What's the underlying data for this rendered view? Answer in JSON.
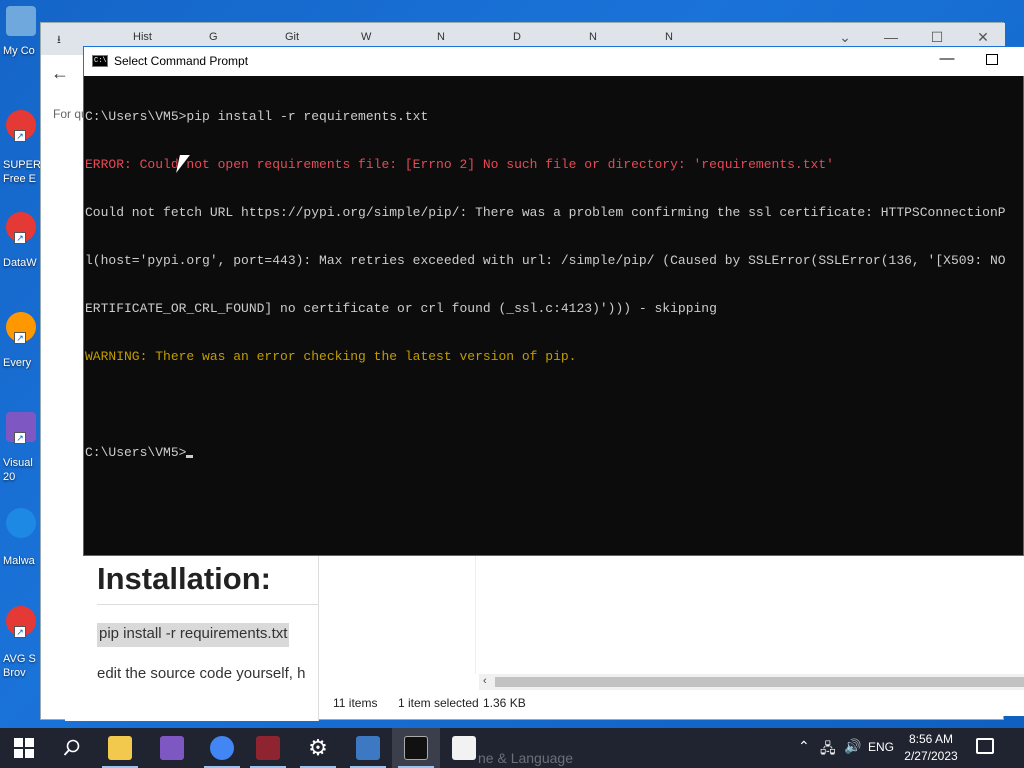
{
  "desktop": {
    "icons": [
      {
        "label": "My Co",
        "color": "#6fa8dc"
      },
      {
        "label": "SUPER",
        "label2": "Free E",
        "color": "#e53935"
      },
      {
        "label": "DataW",
        "color": "#e53935"
      },
      {
        "label": "Every",
        "color": "#ff9800"
      },
      {
        "label": "Visual",
        "label2": "20",
        "color": "#7e57c2"
      },
      {
        "label": "Malwa",
        "color": "#1e88e5"
      },
      {
        "label": "AVG S",
        "label2": "Brov",
        "color": "#e53935"
      }
    ]
  },
  "browser": {
    "tabs": [
      "",
      "Hist",
      "G",
      "Git",
      "W",
      "N",
      "D",
      "N",
      "N"
    ],
    "for_q": "For qu",
    "install_title": "Installation:",
    "code_line": "pip install -r requirements.txt",
    "edit_text": "edit the source code yourself, h"
  },
  "explorer": {
    "items_count": "11 items",
    "selected": "1 item selected",
    "size": "1.36 KB"
  },
  "cmd": {
    "title": "Select Command Prompt",
    "icon_text": "C:\\",
    "lines": [
      {
        "cls": "",
        "text": "C:\\Users\\VM5>pip install -r requirements.txt"
      },
      {
        "cls": "err",
        "text": "ERROR: Could not open requirements file: [Errno 2] No such file or directory: 'requirements.txt'"
      },
      {
        "cls": "",
        "text": "Could not fetch URL https://pypi.org/simple/pip/: There was a problem confirming the ssl certificate: HTTPSConnectionP"
      },
      {
        "cls": "",
        "text": "l(host='pypi.org', port=443): Max retries exceeded with url: /simple/pip/ (Caused by SSLError(SSLError(136, '[X509: NO"
      },
      {
        "cls": "",
        "text": "ERTIFICATE_OR_CRL_FOUND] no certificate or crl found (_ssl.c:4123)'))) - skipping"
      },
      {
        "cls": "warn",
        "text": "WARNING: There was an error checking the latest version of pip."
      },
      {
        "cls": "",
        "text": ""
      },
      {
        "cls": "",
        "text": "C:\\Users\\VM5>"
      }
    ]
  },
  "taskbar": {
    "apps": [
      {
        "name": "file-explorer",
        "color": "#f2c94c"
      },
      {
        "name": "visual-studio",
        "color": "#7e57c2"
      },
      {
        "name": "browser",
        "color": "#4285f4"
      },
      {
        "name": "winrar",
        "color": "#8e2430"
      },
      {
        "name": "settings",
        "color": "#cfd3da"
      },
      {
        "name": "python",
        "color": "#3d78c2"
      },
      {
        "name": "command-prompt",
        "color": "#111111"
      },
      {
        "name": "store",
        "color": "#f2f2f2"
      }
    ],
    "language": "ENG",
    "time": "8:56 AM",
    "date": "2/27/2023",
    "ghost_text": "ne & Language"
  },
  "colors": {
    "error": "#e74856",
    "warning": "#c19c00",
    "console_text": "#cccccc",
    "console_bg": "#0c0c0c"
  }
}
